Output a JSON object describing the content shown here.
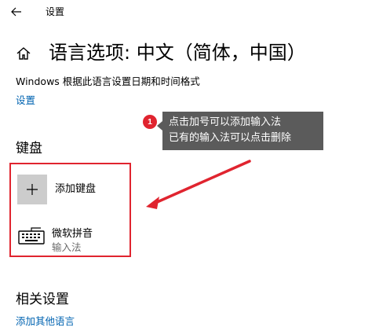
{
  "window": {
    "title": "设置",
    "back_icon": "arrow-left-icon"
  },
  "header": {
    "home_icon": "home-icon",
    "title": "语言选项: 中文（简体，中国）",
    "format_note": "Windows 根据此语言设置日期和时间格式",
    "settings_link": "设置"
  },
  "annotation": {
    "badge": "1",
    "lines": [
      "点击加号可以添加输入法",
      "已有的输入法可以点击删除"
    ],
    "accent": "#e0242f",
    "callout_bg": "#5b5b5b"
  },
  "keyboard": {
    "section_title": "键盘",
    "add_label": "添加键盘",
    "add_icon": "plus-icon",
    "items": [
      {
        "name": "微软拼音",
        "type": "输入法",
        "icon": "keyboard-icon"
      }
    ]
  },
  "related": {
    "section_title": "相关设置",
    "link": "添加其他语言"
  },
  "colors": {
    "link": "#0063b1",
    "tile": "#cccccc",
    "highlight": "#e0242f"
  }
}
